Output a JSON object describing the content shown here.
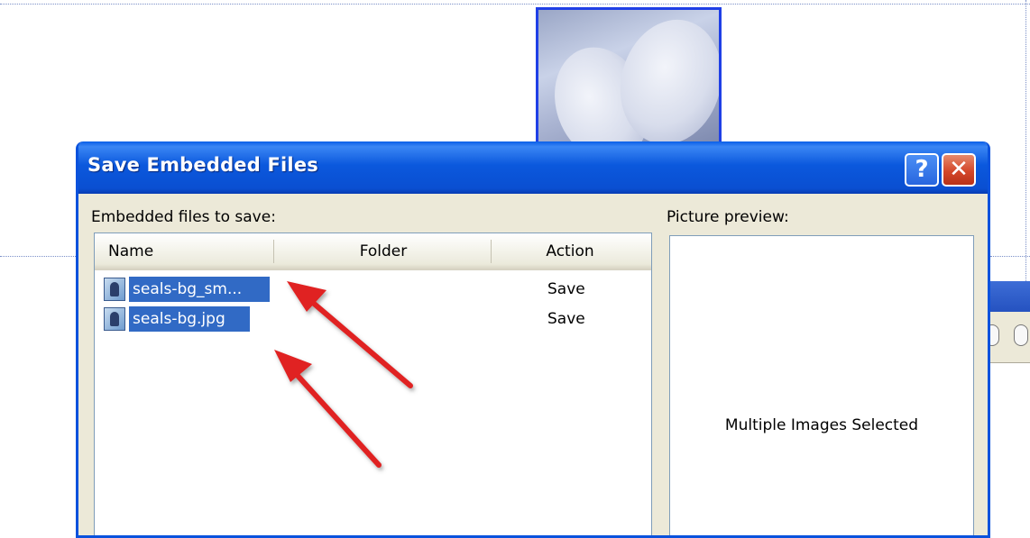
{
  "dialog": {
    "title": "Save Embedded Files",
    "help_button": "?",
    "close_button": "✕",
    "files_label": "Embedded files to save:",
    "preview_label": "Picture preview:",
    "preview_message": "Multiple Images Selected"
  },
  "table": {
    "columns": [
      "Name",
      "Folder",
      "Action"
    ],
    "rows": [
      {
        "name": "seals-bg_sm...",
        "folder": "",
        "action": "Save"
      },
      {
        "name": "seals-bg.jpg",
        "folder": "",
        "action": "Save"
      }
    ]
  },
  "icons": {
    "file_icon": "image-file-icon",
    "help": "question-icon",
    "close": "close-icon",
    "annotation": "red-arrow-icon"
  },
  "colors": {
    "titlebar": "#0a52dd",
    "selection": "#316ac5",
    "annotation": "#e02020",
    "dialog_bg": "#ece9d8"
  }
}
